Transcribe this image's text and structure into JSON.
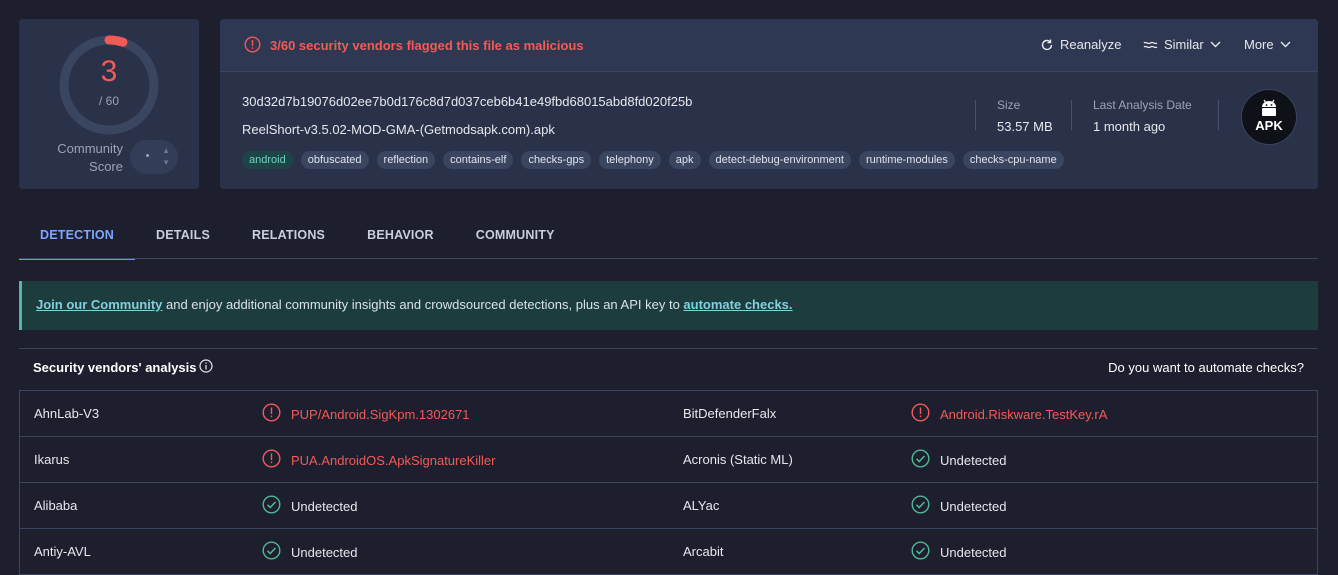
{
  "score": {
    "detections": "3",
    "total": "/ 60",
    "detection_ratio": 0.05,
    "community_label": "Community\nScore",
    "community_value": "·"
  },
  "header": {
    "alert": "3/60 security vendors flagged this file as malicious",
    "reanalyze": "Reanalyze",
    "similar": "Similar",
    "more": "More",
    "hash": "30d32d7b19076d02ee7b0d176c8d7d037ceb6b41e49fbd68015abd8fd020f25b",
    "filename": "ReelShort-v3.5.02-MOD-GMA-(Getmodsapk.com).apk",
    "tags": [
      "android",
      "obfuscated",
      "reflection",
      "contains-elf",
      "checks-gps",
      "telephony",
      "apk",
      "detect-debug-environment",
      "runtime-modules",
      "checks-cpu-name"
    ],
    "size_label": "Size",
    "size_value": "53.57 MB",
    "last_label": "Last Analysis Date",
    "last_value": "1 month ago",
    "file_type": "APK"
  },
  "tabs": [
    "DETECTION",
    "DETAILS",
    "RELATIONS",
    "BEHAVIOR",
    "COMMUNITY"
  ],
  "banner": {
    "link1": "Join our Community",
    "middle": " and enjoy additional community insights and crowdsourced detections, plus an API key to ",
    "link2": "automate checks."
  },
  "vendors": {
    "title": "Security vendors' analysis",
    "automate": "Do you want to automate checks?",
    "rows": [
      [
        {
          "name": "AhnLab-V3",
          "result": "PUP/Android.SigKpm.1302671",
          "malicious": true
        },
        {
          "name": "BitDefenderFalx",
          "result": "Android.Riskware.TestKey.rA",
          "malicious": true
        }
      ],
      [
        {
          "name": "Ikarus",
          "result": "PUA.AndroidOS.ApkSignatureKiller",
          "malicious": true
        },
        {
          "name": "Acronis (Static ML)",
          "result": "Undetected",
          "malicious": false
        }
      ],
      [
        {
          "name": "Alibaba",
          "result": "Undetected",
          "malicious": false
        },
        {
          "name": "ALYac",
          "result": "Undetected",
          "malicious": false
        }
      ],
      [
        {
          "name": "Antiy-AVL",
          "result": "Undetected",
          "malicious": false
        },
        {
          "name": "Arcabit",
          "result": "Undetected",
          "malicious": false
        }
      ]
    ]
  },
  "colors": {
    "malicious": "#f35a56",
    "clean": "#4fb896",
    "accent": "#6f95f0"
  }
}
